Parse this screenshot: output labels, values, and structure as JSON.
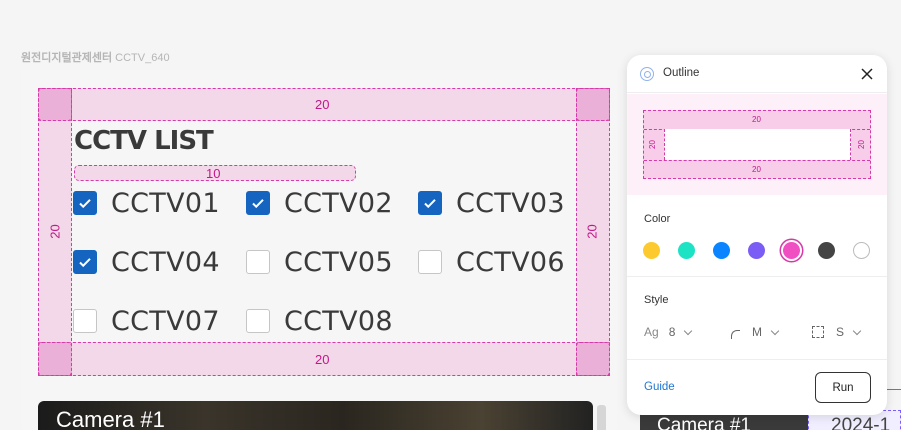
{
  "frame": {
    "label_ko": "원전디지털관제센터",
    "label_en": "CCTV_640"
  },
  "outline": {
    "top": "20",
    "bottom": "20",
    "left": "20",
    "right": "20",
    "gap": "10"
  },
  "list": {
    "title": "CCTV LIST",
    "items": [
      {
        "label": "CCTV01",
        "checked": true
      },
      {
        "label": "CCTV02",
        "checked": true
      },
      {
        "label": "CCTV03",
        "checked": true
      },
      {
        "label": "CCTV04",
        "checked": true
      },
      {
        "label": "CCTV05",
        "checked": false
      },
      {
        "label": "CCTV06",
        "checked": false
      },
      {
        "label": "CCTV07",
        "checked": false
      },
      {
        "label": "CCTV08",
        "checked": false
      }
    ]
  },
  "camera": {
    "title": "Camera #1"
  },
  "background": {
    "camera_title": "Camera #1",
    "date_fragment": "2024-1"
  },
  "panel": {
    "title": "Outline",
    "preview": {
      "top": "20",
      "bottom": "20",
      "left": "20",
      "right": "20"
    },
    "color_label": "Color",
    "colors": [
      "#fcca2f",
      "#1de3c5",
      "#0a84ff",
      "#7b5cf5",
      "#f04fc2",
      "#444444",
      "#ffffff"
    ],
    "selected_color": "#f04fc2",
    "style_label": "Style",
    "style": {
      "text_icon": "Ag",
      "text_value": "8",
      "radius_value": "M",
      "border_value": "S"
    },
    "guide_label": "Guide",
    "run_label": "Run"
  },
  "accent_color": "#d63aa8",
  "checkbox_color": "#1565c0"
}
